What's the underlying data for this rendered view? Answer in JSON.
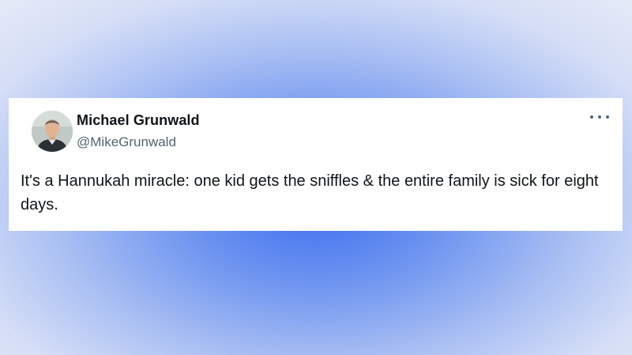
{
  "tweet": {
    "author_name": "Michael Grunwald",
    "author_handle": "@MikeGrunwald",
    "text": "It's a Hannukah miracle: one kid gets the sniffles & the entire family is sick for eight days.",
    "more_icon": "more-horizontal-icon"
  },
  "colors": {
    "background_center": "#3d6ff0",
    "background_edge": "#e6ebf7",
    "card": "#ffffff",
    "name_text": "#0f1419",
    "handle_text": "#536471"
  }
}
